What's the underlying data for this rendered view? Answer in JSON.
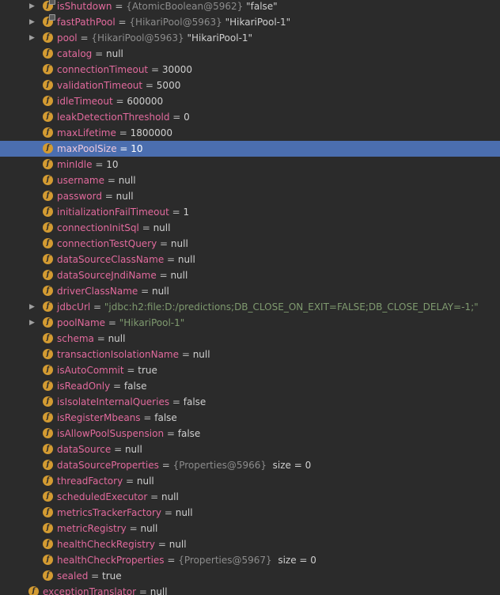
{
  "rows": [
    {
      "name": "isShutdown",
      "ref": "{AtomicBoolean@5962}",
      "value": "\"false\"",
      "expandable": true,
      "locked": true
    },
    {
      "name": "fastPathPool",
      "ref": "{HikariPool@5963}",
      "value": "\"HikariPool-1\"",
      "expandable": true,
      "locked": true
    },
    {
      "name": "pool",
      "ref": "{HikariPool@5963}",
      "value": "\"HikariPool-1\"",
      "expandable": true
    },
    {
      "name": "catalog",
      "value": "null"
    },
    {
      "name": "connectionTimeout",
      "value": "30000"
    },
    {
      "name": "validationTimeout",
      "value": "5000"
    },
    {
      "name": "idleTimeout",
      "value": "600000"
    },
    {
      "name": "leakDetectionThreshold",
      "value": "0"
    },
    {
      "name": "maxLifetime",
      "value": "1800000"
    },
    {
      "name": "maxPoolSize",
      "value": "10",
      "selected": true
    },
    {
      "name": "minIdle",
      "value": "10"
    },
    {
      "name": "username",
      "value": "null"
    },
    {
      "name": "password",
      "value": "null"
    },
    {
      "name": "initializationFailTimeout",
      "value": "1"
    },
    {
      "name": "connectionInitSql",
      "value": "null"
    },
    {
      "name": "connectionTestQuery",
      "value": "null"
    },
    {
      "name": "dataSourceClassName",
      "value": "null"
    },
    {
      "name": "dataSourceJndiName",
      "value": "null"
    },
    {
      "name": "driverClassName",
      "value": "null"
    },
    {
      "name": "jdbcUrl",
      "str": "\"jdbc:h2:file:D:/predictions;DB_CLOSE_ON_EXIT=FALSE;DB_CLOSE_DELAY=-1;\"",
      "expandable": true
    },
    {
      "name": "poolName",
      "str": "\"HikariPool-1\"",
      "expandable": true
    },
    {
      "name": "schema",
      "value": "null"
    },
    {
      "name": "transactionIsolationName",
      "value": "null"
    },
    {
      "name": "isAutoCommit",
      "value": "true"
    },
    {
      "name": "isReadOnly",
      "value": "false"
    },
    {
      "name": "isIsolateInternalQueries",
      "value": "false"
    },
    {
      "name": "isRegisterMbeans",
      "value": "false"
    },
    {
      "name": "isAllowPoolSuspension",
      "value": "false"
    },
    {
      "name": "dataSource",
      "value": "null"
    },
    {
      "name": "dataSourceProperties",
      "ref": "{Properties@5966}",
      "value": " size = 0"
    },
    {
      "name": "threadFactory",
      "value": "null"
    },
    {
      "name": "scheduledExecutor",
      "value": "null"
    },
    {
      "name": "metricsTrackerFactory",
      "value": "null"
    },
    {
      "name": "metricRegistry",
      "value": "null"
    },
    {
      "name": "healthCheckRegistry",
      "value": "null"
    },
    {
      "name": "healthCheckProperties",
      "ref": "{Properties@5967}",
      "value": " size = 0"
    },
    {
      "name": "sealed",
      "value": "true"
    },
    {
      "name": "exceptionTranslator",
      "value": "null",
      "outdent": true
    }
  ],
  "icon_letter": "f",
  "expand_glyph": "▶",
  "equals": " = ",
  "colors": {
    "background": "#2b2b2b",
    "selection": "#4b6eaf",
    "field_name": "#e26a9d",
    "field_icon": "#d39b32",
    "string_value": "#7f9a6f",
    "ref_value": "#8c8c8c"
  }
}
